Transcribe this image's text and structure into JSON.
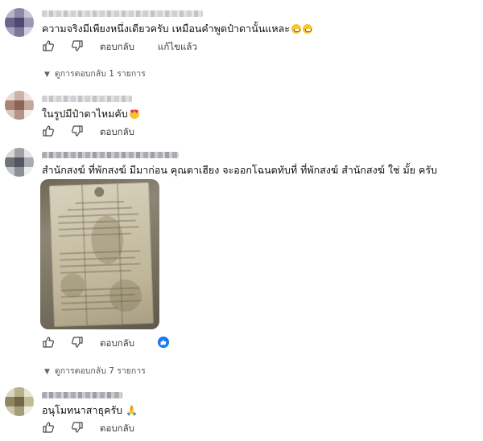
{
  "comments": [
    {
      "text": "ความจริงมีเพียงหนึ่งเดียวครับ เหมือนคำพูดป๋าดานั้นแหละ",
      "actions": {
        "reply": "ตอบกลับ",
        "edited": "แก้ไขแล้ว"
      },
      "replies_toggle": "ดูการตอบกลับ 1 รายการ"
    },
    {
      "text": "ในรูปมีป๋าดาไหมคับ",
      "actions": {
        "reply": "ตอบกลับ"
      }
    },
    {
      "text": "สำนักสงฆ์ ที่พักสงฆ์ มีมาก่อน คุณตาเฮียง จะออกโฉนดทับที่ ที่พักสงฆ์ สำนักสงฆ์ ใช่ มั้ย ครับ",
      "actions": {
        "reply": "ตอบกลับ"
      },
      "replies_toggle": "ดูการตอบกลับ 7 รายการ"
    },
    {
      "text": "อนุโมทนาสาธุครับ",
      "actions": {
        "reply": "ตอบกลับ"
      }
    }
  ],
  "icons": {
    "like": "thumbs-up-icon",
    "dislike": "thumbs-down-icon",
    "expand": "chevron-down-icon",
    "reaction": "like-reaction-icon"
  },
  "colors": {
    "accent": "#1877f2",
    "text": "#0f0f0f",
    "secondary": "#3e3e3e"
  }
}
